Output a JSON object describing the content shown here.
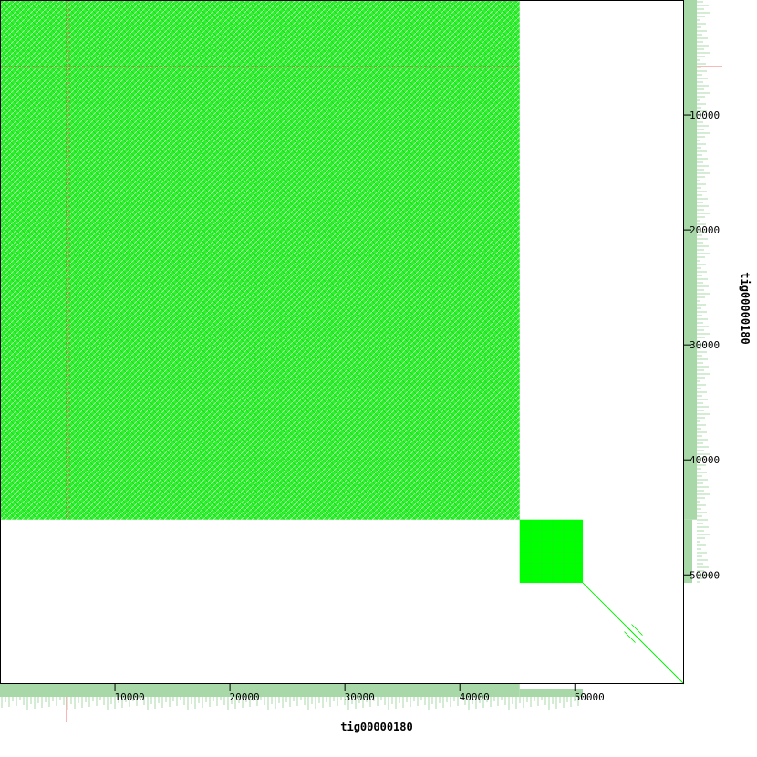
{
  "chart_data": {
    "type": "scatter",
    "title": "",
    "xlabel": "tig00000180",
    "ylabel": "tig00000180",
    "xlim": [
      0,
      59500
    ],
    "ylim": [
      0,
      59500
    ],
    "y_inverted": true,
    "x_ticks": [
      {
        "value": 10000,
        "label": "10000"
      },
      {
        "value": 20000,
        "label": "20000"
      },
      {
        "value": 30000,
        "label": "30000"
      },
      {
        "value": 40000,
        "label": "40000"
      },
      {
        "value": 50000,
        "label": "50000"
      }
    ],
    "y_ticks": [
      {
        "value": 10000,
        "label": "10000"
      },
      {
        "value": 20000,
        "label": "20000"
      },
      {
        "value": 30000,
        "label": "30000"
      },
      {
        "value": 40000,
        "label": "40000"
      },
      {
        "value": 50000,
        "label": "50000"
      }
    ],
    "grid": false,
    "colors": {
      "forward_match": "#00ee00",
      "dense_block": "#00ff00",
      "reverse_match": "#ee4444",
      "coverage_track": "#a8d8a8",
      "frame": "#000000"
    },
    "regions": [
      {
        "name": "tandem-repeat-block",
        "x0": 0,
        "x1": 45200,
        "y0": 0,
        "y1": 45200
      },
      {
        "name": "second-repeat-block",
        "x0": 45200,
        "x1": 50700,
        "y0": 45200,
        "y1": 50700
      }
    ],
    "diagonals": [
      {
        "name": "main-diagonal-tail",
        "x0": 50700,
        "y0": 50700,
        "x1": 59500,
        "y1": 59500
      }
    ],
    "reverse_matches": [
      {
        "name": "reverse-vertical-line",
        "x": 5800,
        "y0": 0,
        "y1": 45200
      },
      {
        "name": "reverse-horizontal-line",
        "y": 5800,
        "x0": 0,
        "x1": 45200
      }
    ]
  }
}
